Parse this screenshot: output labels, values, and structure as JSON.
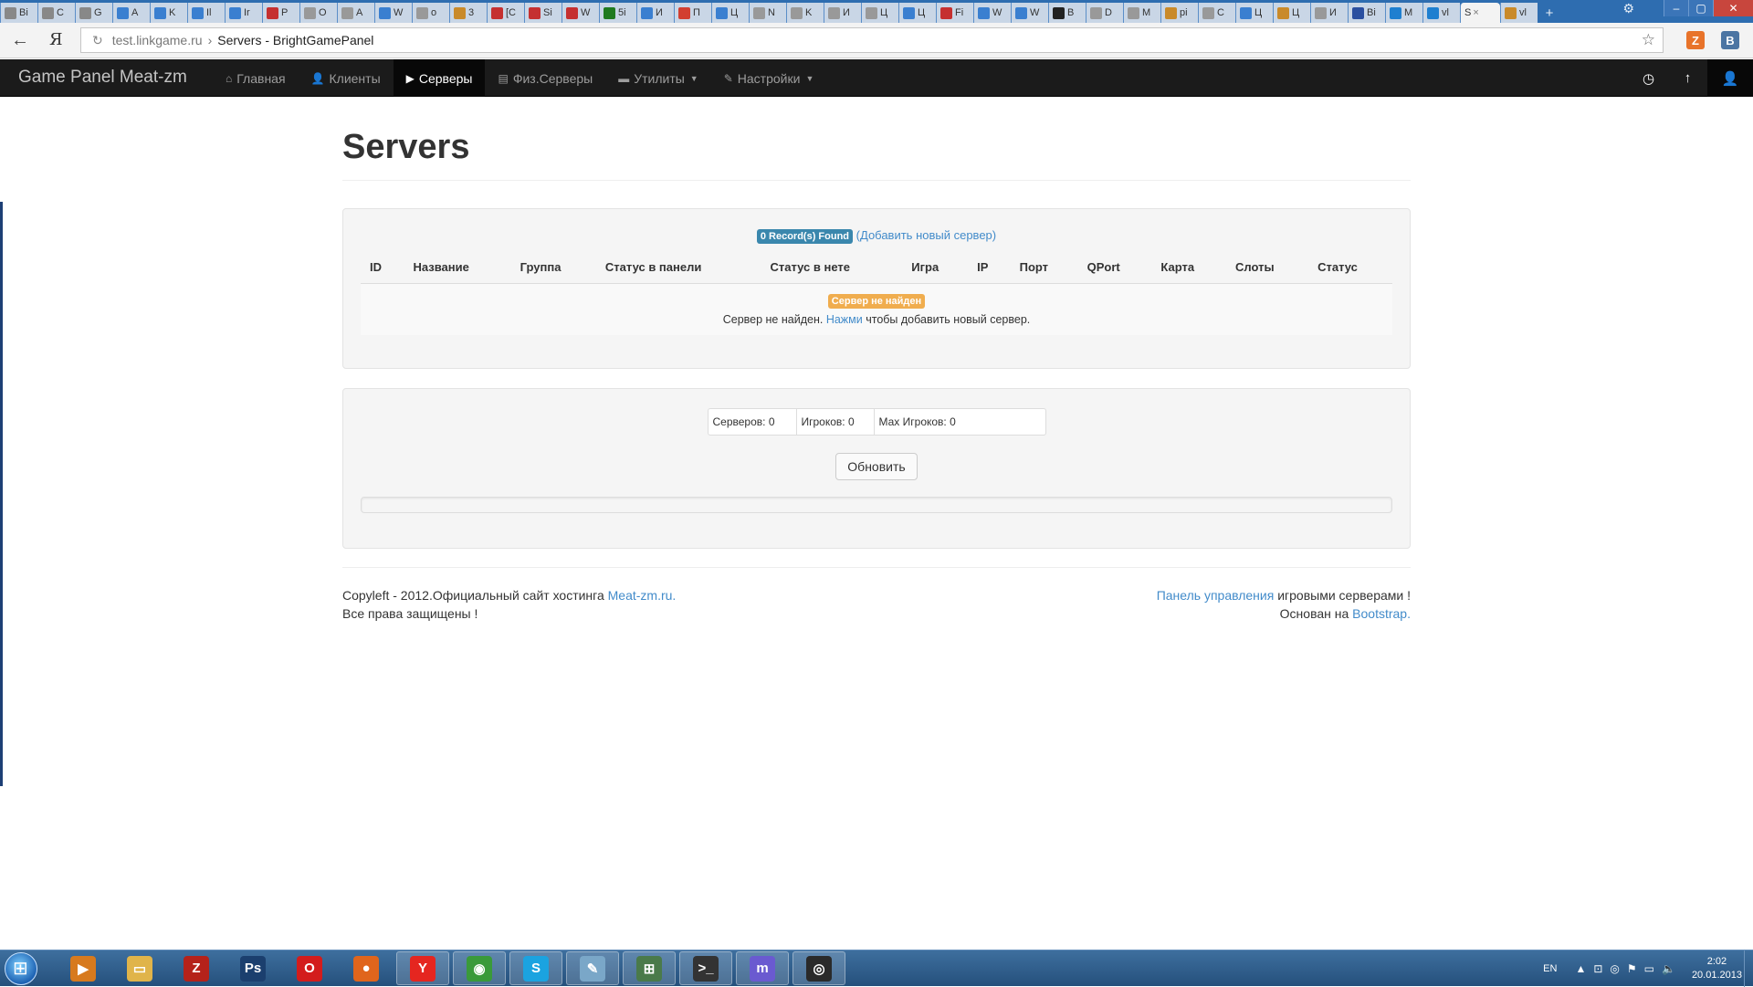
{
  "browser": {
    "tabs": [
      {
        "label": "Bi",
        "color": "#888"
      },
      {
        "label": "C",
        "color": "#888"
      },
      {
        "label": "G",
        "color": "#888"
      },
      {
        "label": "A",
        "color": "#3a7fd0"
      },
      {
        "label": "K",
        "color": "#3a7fd0"
      },
      {
        "label": "Il",
        "color": "#3a7fd0"
      },
      {
        "label": "Ir",
        "color": "#3a7fd0"
      },
      {
        "label": "P",
        "color": "#c53030"
      },
      {
        "label": "O",
        "color": "#999"
      },
      {
        "label": "A",
        "color": "#999"
      },
      {
        "label": "W",
        "color": "#3a7fd0"
      },
      {
        "label": "o",
        "color": "#999"
      },
      {
        "label": "3",
        "color": "#c98a2a"
      },
      {
        "label": "[C",
        "color": "#c53030"
      },
      {
        "label": "Si",
        "color": "#c53030"
      },
      {
        "label": "W",
        "color": "#c53030"
      },
      {
        "label": "5i",
        "color": "#1f7a1f"
      },
      {
        "label": "И",
        "color": "#3a7fd0"
      },
      {
        "label": "П",
        "color": "#d23f31"
      },
      {
        "label": "Ц",
        "color": "#3a7fd0"
      },
      {
        "label": "N",
        "color": "#999"
      },
      {
        "label": "K",
        "color": "#999"
      },
      {
        "label": "И",
        "color": "#999"
      },
      {
        "label": "Ц",
        "color": "#999"
      },
      {
        "label": "Ц",
        "color": "#3a7fd0"
      },
      {
        "label": "Fi",
        "color": "#c53030"
      },
      {
        "label": "W",
        "color": "#3a7fd0"
      },
      {
        "label": "W",
        "color": "#3a7fd0"
      },
      {
        "label": "B",
        "color": "#222"
      },
      {
        "label": "D",
        "color": "#999"
      },
      {
        "label": "M",
        "color": "#999"
      },
      {
        "label": "pi",
        "color": "#c98a2a"
      },
      {
        "label": "C",
        "color": "#999"
      },
      {
        "label": "Ц",
        "color": "#3a7fd0"
      },
      {
        "label": "Ц",
        "color": "#c98a2a"
      },
      {
        "label": "И",
        "color": "#999"
      },
      {
        "label": "Bi",
        "color": "#2a4fa0"
      },
      {
        "label": "M",
        "color": "#1e7fd0"
      },
      {
        "label": "vl",
        "color": "#1e7fd0"
      }
    ],
    "active_tab": {
      "label": "S",
      "close": "×"
    },
    "after_tab": {
      "label": "vl",
      "color": "#c98a2a"
    },
    "new_tab": "+",
    "address": {
      "host": "test.linkgame.ru",
      "separator": "›",
      "title": "Servers - BrightGamePanel"
    },
    "ext1": "Z",
    "ext2": "B"
  },
  "navbar": {
    "brand": "Game Panel Meat-zm",
    "items": [
      {
        "label": "Главная",
        "icon": "⌂",
        "active": false
      },
      {
        "label": "Клиенты",
        "icon": "👤",
        "active": false
      },
      {
        "label": "Серверы",
        "icon": "▶",
        "active": true
      },
      {
        "label": "Физ.Серверы",
        "icon": "▤",
        "active": false
      },
      {
        "label": "Утилиты",
        "icon": "▬",
        "active": false,
        "dropdown": true
      },
      {
        "label": "Настройки",
        "icon": "✎",
        "active": false,
        "dropdown": true
      }
    ]
  },
  "page": {
    "title": "Servers",
    "records_badge": "0 Record(s) Found",
    "add_link_open": "(",
    "add_link": "Добавить новый сервер",
    "add_link_close": ")",
    "columns": [
      "ID",
      "Название",
      "Группа",
      "Статус в панели",
      "Статус в нете",
      "Игра",
      "IP",
      "Порт",
      "QPort",
      "Карта",
      "Слоты",
      "Статус"
    ],
    "empty_badge": "Сервер не найден",
    "empty_text_before": "Сервер не найден.",
    "empty_link": "Нажми",
    "empty_text_after": "чтобы добавить новый сервер.",
    "stats": {
      "servers": "Серверов: 0",
      "players": "Игроков: 0",
      "max_players": "Мах Игроков: 0"
    },
    "refresh_button": "Обновить"
  },
  "footer": {
    "left_line1_text": "Copyleft - 2012.Официальный сайт хостинга",
    "left_line1_link": "Meat-zm.ru.",
    "left_line2": "Все права защищены !",
    "right_line1_link": "Панель управления",
    "right_line1_text": "игровыми серверами !",
    "right_line2_text": "Основан на",
    "right_line2_link": "Bootstrap."
  },
  "taskbar": {
    "apps": [
      {
        "name": "media-player",
        "glyph": "▶",
        "color": "#d77a1e"
      },
      {
        "name": "explorer",
        "glyph": "▭",
        "color": "#e0b44a"
      },
      {
        "name": "filezilla",
        "glyph": "Z",
        "color": "#b5221a"
      },
      {
        "name": "photoshop",
        "glyph": "Ps",
        "color": "#1b3f6e"
      },
      {
        "name": "opera",
        "glyph": "O",
        "color": "#d31c1c"
      },
      {
        "name": "firefox",
        "glyph": "●",
        "color": "#e0651c"
      },
      {
        "name": "yandex",
        "glyph": "Y",
        "color": "#e52620"
      },
      {
        "name": "chrome",
        "glyph": "◉",
        "color": "#3a9a3a"
      },
      {
        "name": "skype",
        "glyph": "S",
        "color": "#1ba3e0"
      },
      {
        "name": "notepad",
        "glyph": "✎",
        "color": "#7aa7c8"
      },
      {
        "name": "network",
        "glyph": "⊞",
        "color": "#4a7a4a"
      },
      {
        "name": "terminal",
        "glyph": ">_",
        "color": "#333"
      },
      {
        "name": "mirc",
        "glyph": "m",
        "color": "#6a5ad0"
      },
      {
        "name": "steam",
        "glyph": "◎",
        "color": "#2a2a2a"
      }
    ],
    "lang": "EN",
    "time": "2:02",
    "date": "20.01.2013"
  }
}
